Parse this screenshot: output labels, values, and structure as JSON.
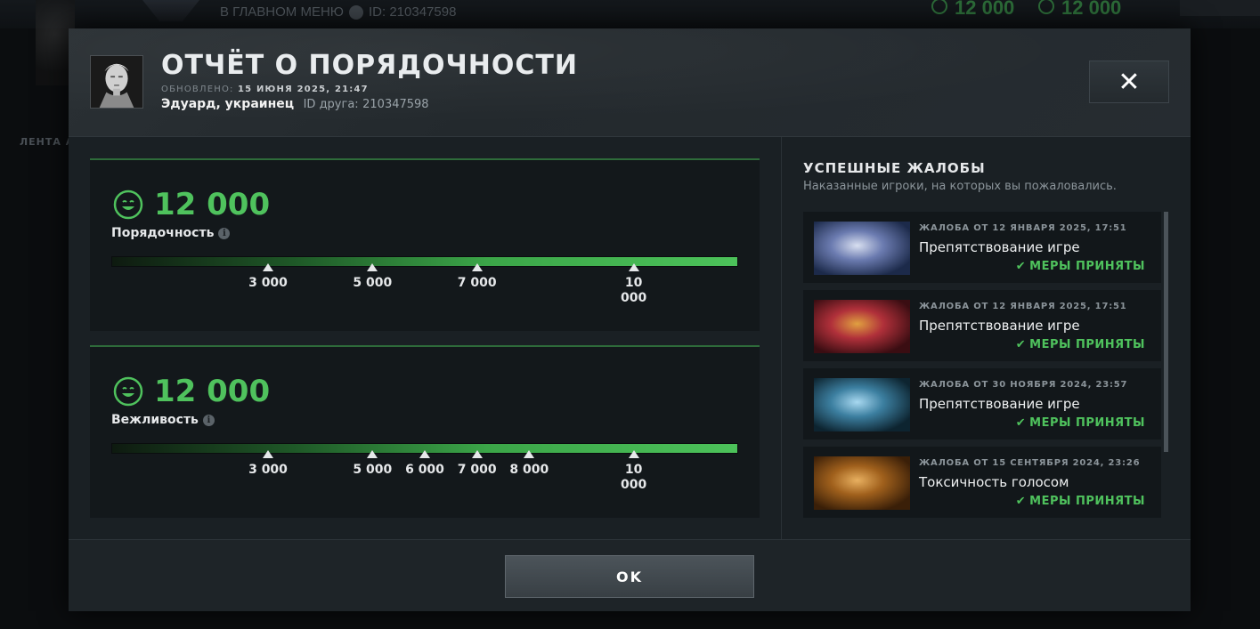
{
  "background": {
    "menu_link": "В ГЛАВНОМ МЕНЮ",
    "steam_id": "ID: 210347598",
    "currency_a": "12 000",
    "currency_b": "12 000",
    "feed_label": "ЛЕНТА А"
  },
  "header": {
    "title": "ОТЧЁТ О ПОРЯДОЧНОСТИ",
    "updated_label": "ОБНОВЛЕНО:",
    "updated_value": "15 ИЮНЯ 2025, 21:47",
    "user_name": "Эдуард, украинец",
    "friend_id_label": "ID друга:",
    "friend_id": "210347598",
    "close_symbol": "✕"
  },
  "stats": [
    {
      "value": "12 000",
      "label": "Порядочность",
      "info": "i",
      "bar_fill": 1.0,
      "ticks": [
        {
          "label": "3 000",
          "value": 3000
        },
        {
          "label": "5 000",
          "value": 5000
        },
        {
          "label": "7 000",
          "value": 7000
        },
        {
          "label": "10\n000",
          "value": 10000
        }
      ]
    },
    {
      "value": "12 000",
      "label": "Вежливость",
      "info": "i",
      "bar_fill": 1.0,
      "ticks": [
        {
          "label": "3 000",
          "value": 3000
        },
        {
          "label": "5 000",
          "value": 5000
        },
        {
          "label": "6 000",
          "value": 6000
        },
        {
          "label": "7 000",
          "value": 7000
        },
        {
          "label": "8 000",
          "value": 8000
        },
        {
          "label": "10\n000",
          "value": 10000
        }
      ]
    }
  ],
  "reports": {
    "title": "УСПЕШНЫЕ ЖАЛОБЫ",
    "subtitle": "Наказанные игроки, на которых вы пожаловались.",
    "items": [
      {
        "date": "ЖАЛОБА ОТ 12 ЯНВАРЯ 2025, 17:51",
        "reason": "Препятствование игре",
        "status": "МЕРЫ ПРИНЯТЫ",
        "hero_icon": "hero-portrait-vengeful-icon",
        "colors": [
          "#1c2a4a",
          "#6b7bb0",
          "#d8dff0"
        ]
      },
      {
        "date": "ЖАЛОБА ОТ 12 ЯНВАРЯ 2025, 17:51",
        "reason": "Препятствование игре",
        "status": "МЕРЫ ПРИНЯТЫ",
        "hero_icon": "hero-portrait-demon-icon",
        "colors": [
          "#3a0d12",
          "#b0303a",
          "#e0a040"
        ]
      },
      {
        "date": "ЖАЛОБА ОТ 30 НОЯБРЯ 2024, 23:57",
        "reason": "Препятствование игре",
        "status": "МЕРЫ ПРИНЯТЫ",
        "hero_icon": "hero-portrait-spirit-icon",
        "colors": [
          "#0d2430",
          "#3c7fa0",
          "#a8d8f0"
        ]
      },
      {
        "date": "ЖАЛОБА ОТ 15 СЕНТЯБРЯ 2024, 23:26",
        "reason": "Токсичность голосом",
        "status": "МЕРЫ ПРИНЯТЫ",
        "hero_icon": "hero-portrait-beast-icon",
        "colors": [
          "#3a1f08",
          "#a0601c",
          "#e8b060"
        ]
      }
    ]
  },
  "footer": {
    "ok_label": "OK"
  },
  "colors": {
    "accent_green": "#4fc25d",
    "panel": "#13181b"
  }
}
